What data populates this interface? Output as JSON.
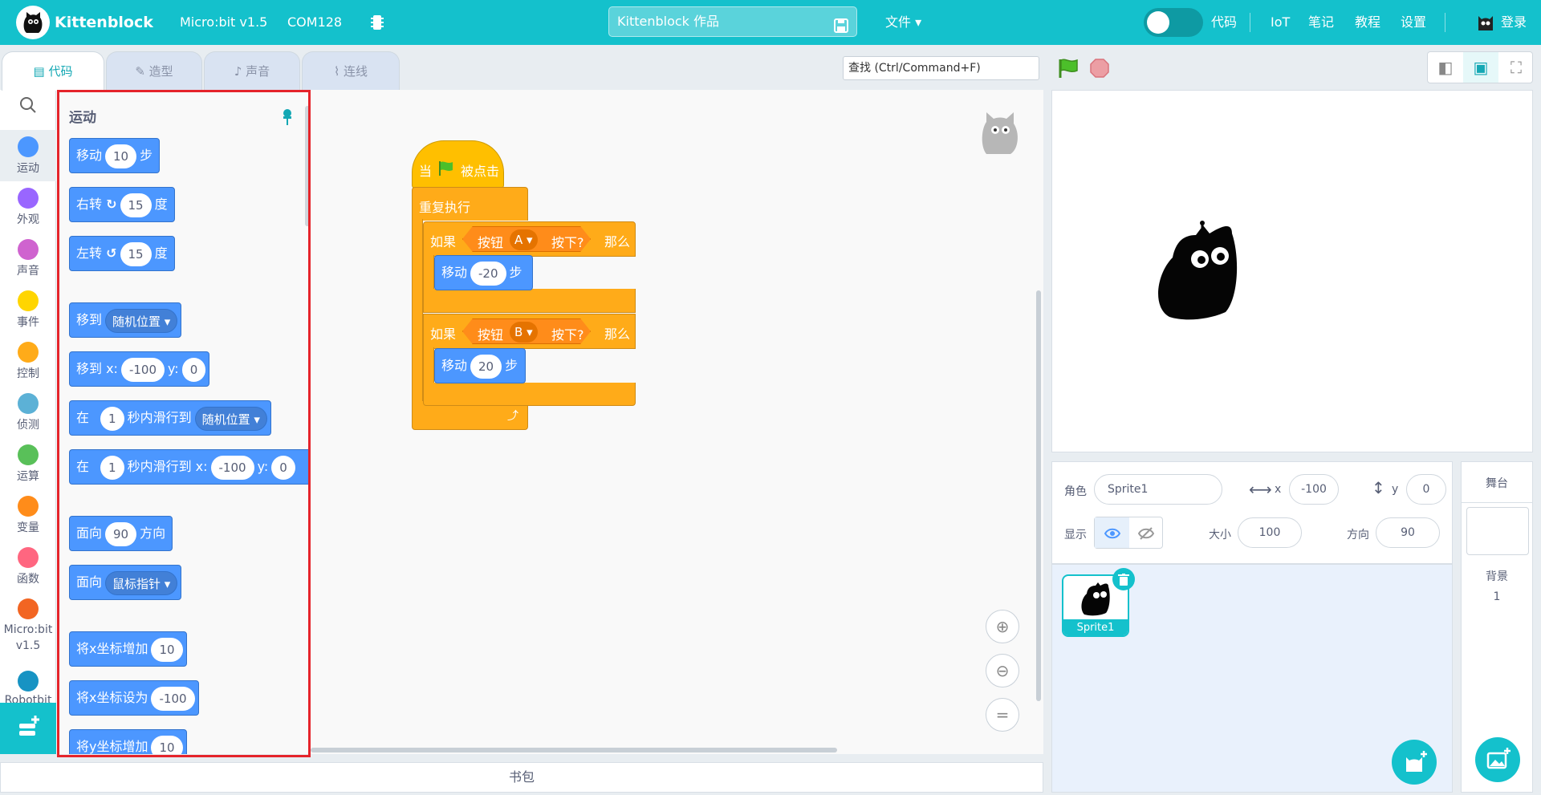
{
  "header": {
    "app_name": "Kittenblock",
    "device": "Micro:bit v1.5",
    "port": "COM128",
    "project_title": "Kittenblock 作品",
    "file_menu": "文件",
    "code_toggle_label": "代码",
    "nav": [
      "IoT",
      "笔记",
      "教程",
      "设置"
    ],
    "login": "登录",
    "brand_color": "#14c1cc"
  },
  "tabs": [
    {
      "label": "代码",
      "icon": "code-icon"
    },
    {
      "label": "造型",
      "icon": "brush-icon"
    },
    {
      "label": "声音",
      "icon": "speaker-icon"
    },
    {
      "label": "连线",
      "icon": "wiring-icon"
    }
  ],
  "search": {
    "placeholder": "查找 (Ctrl/Command+F)"
  },
  "categories": [
    {
      "label": "运动",
      "color": "#4c97ff"
    },
    {
      "label": "外观",
      "color": "#9966ff"
    },
    {
      "label": "声音",
      "color": "#cf63cf"
    },
    {
      "label": "事件",
      "color": "#ffd500"
    },
    {
      "label": "控制",
      "color": "#ffab19"
    },
    {
      "label": "侦测",
      "color": "#5cb1d6"
    },
    {
      "label": "运算",
      "color": "#59c059"
    },
    {
      "label": "变量",
      "color": "#ff8c1a"
    },
    {
      "label": "函数",
      "color": "#ff6680"
    },
    {
      "label": "Micro:bit v1.5",
      "color": "#f26522"
    },
    {
      "label": "Robotbit",
      "color": "#1793c3"
    }
  ],
  "palette": {
    "heading": "运动",
    "blocks": [
      {
        "parts": [
          "移动",
          "10",
          "步"
        ]
      },
      {
        "parts": [
          "右转",
          "↻",
          "15",
          "度"
        ]
      },
      {
        "parts": [
          "左转",
          "↺",
          "15",
          "度"
        ]
      },
      {
        "parts": [
          "移到",
          "随机位置"
        ]
      },
      {
        "parts": [
          "移到 x:",
          "-100",
          "y:",
          "0"
        ]
      },
      {
        "parts": [
          "在",
          "1",
          "秒内滑行到",
          "随机位置"
        ]
      },
      {
        "parts": [
          "在",
          "1",
          "秒内滑行到 x:",
          "-100",
          "y:",
          "0"
        ]
      },
      {
        "parts": [
          "面向",
          "90",
          "方向"
        ]
      },
      {
        "parts": [
          "面向",
          "鼠标指针"
        ]
      },
      {
        "parts": [
          "将x坐标增加",
          "10"
        ]
      },
      {
        "parts": [
          "将x坐标设为",
          "-100"
        ]
      },
      {
        "parts": [
          "将y坐标增加",
          "10"
        ]
      }
    ]
  },
  "script": {
    "hat": {
      "when": "当",
      "clicked": "被点击"
    },
    "forever": "重复执行",
    "if1": {
      "if": "如果",
      "button": "按钮",
      "key": "A",
      "pressed": "按下?",
      "then": "那么"
    },
    "move1": {
      "move": "移动",
      "steps": "-20",
      "unit": "步"
    },
    "if2": {
      "if": "如果",
      "button": "按钮",
      "key": "B",
      "pressed": "按下?",
      "then": "那么"
    },
    "move2": {
      "move": "移动",
      "steps": "20",
      "unit": "步"
    }
  },
  "zoom_buttons": [
    "zoom-in-icon",
    "zoom-out-icon",
    "zoom-reset-icon"
  ],
  "sprite_info": {
    "sprite_label": "角色",
    "sprite_name": "Sprite1",
    "x_label": "x",
    "x_value": "-100",
    "y_label": "y",
    "y_value": "0",
    "show_label": "显示",
    "size_label": "大小",
    "size_value": "100",
    "direction_label": "方向",
    "direction_value": "90"
  },
  "sprites": [
    {
      "name": "Sprite1"
    }
  ],
  "stage_pane": {
    "title": "舞台",
    "backdrop_label": "背景",
    "backdrop_count": "1"
  },
  "backpack": "书包"
}
